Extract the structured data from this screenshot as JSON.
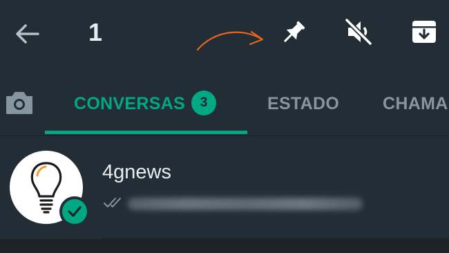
{
  "header": {
    "selected_count": "1",
    "icons": [
      "back-arrow-icon",
      "pin-icon",
      "mute-icon",
      "archive-icon"
    ]
  },
  "tabs": [
    {
      "label": "CONVERSAS",
      "badge": "3",
      "active": true
    },
    {
      "label": "ESTADO",
      "active": false
    },
    {
      "label": "CHAMA",
      "active": false
    }
  ],
  "chat": {
    "name": "4gnews",
    "avatar_icon": "light-bulb-icon",
    "selected_icon": "check-icon",
    "status_icon": "double-check-icon"
  },
  "colors": {
    "background": "#232d36",
    "accent": "#00a884",
    "text_primary": "#e9edef",
    "text_secondary": "#8696a0",
    "annotation_arrow": "#e8651f"
  }
}
